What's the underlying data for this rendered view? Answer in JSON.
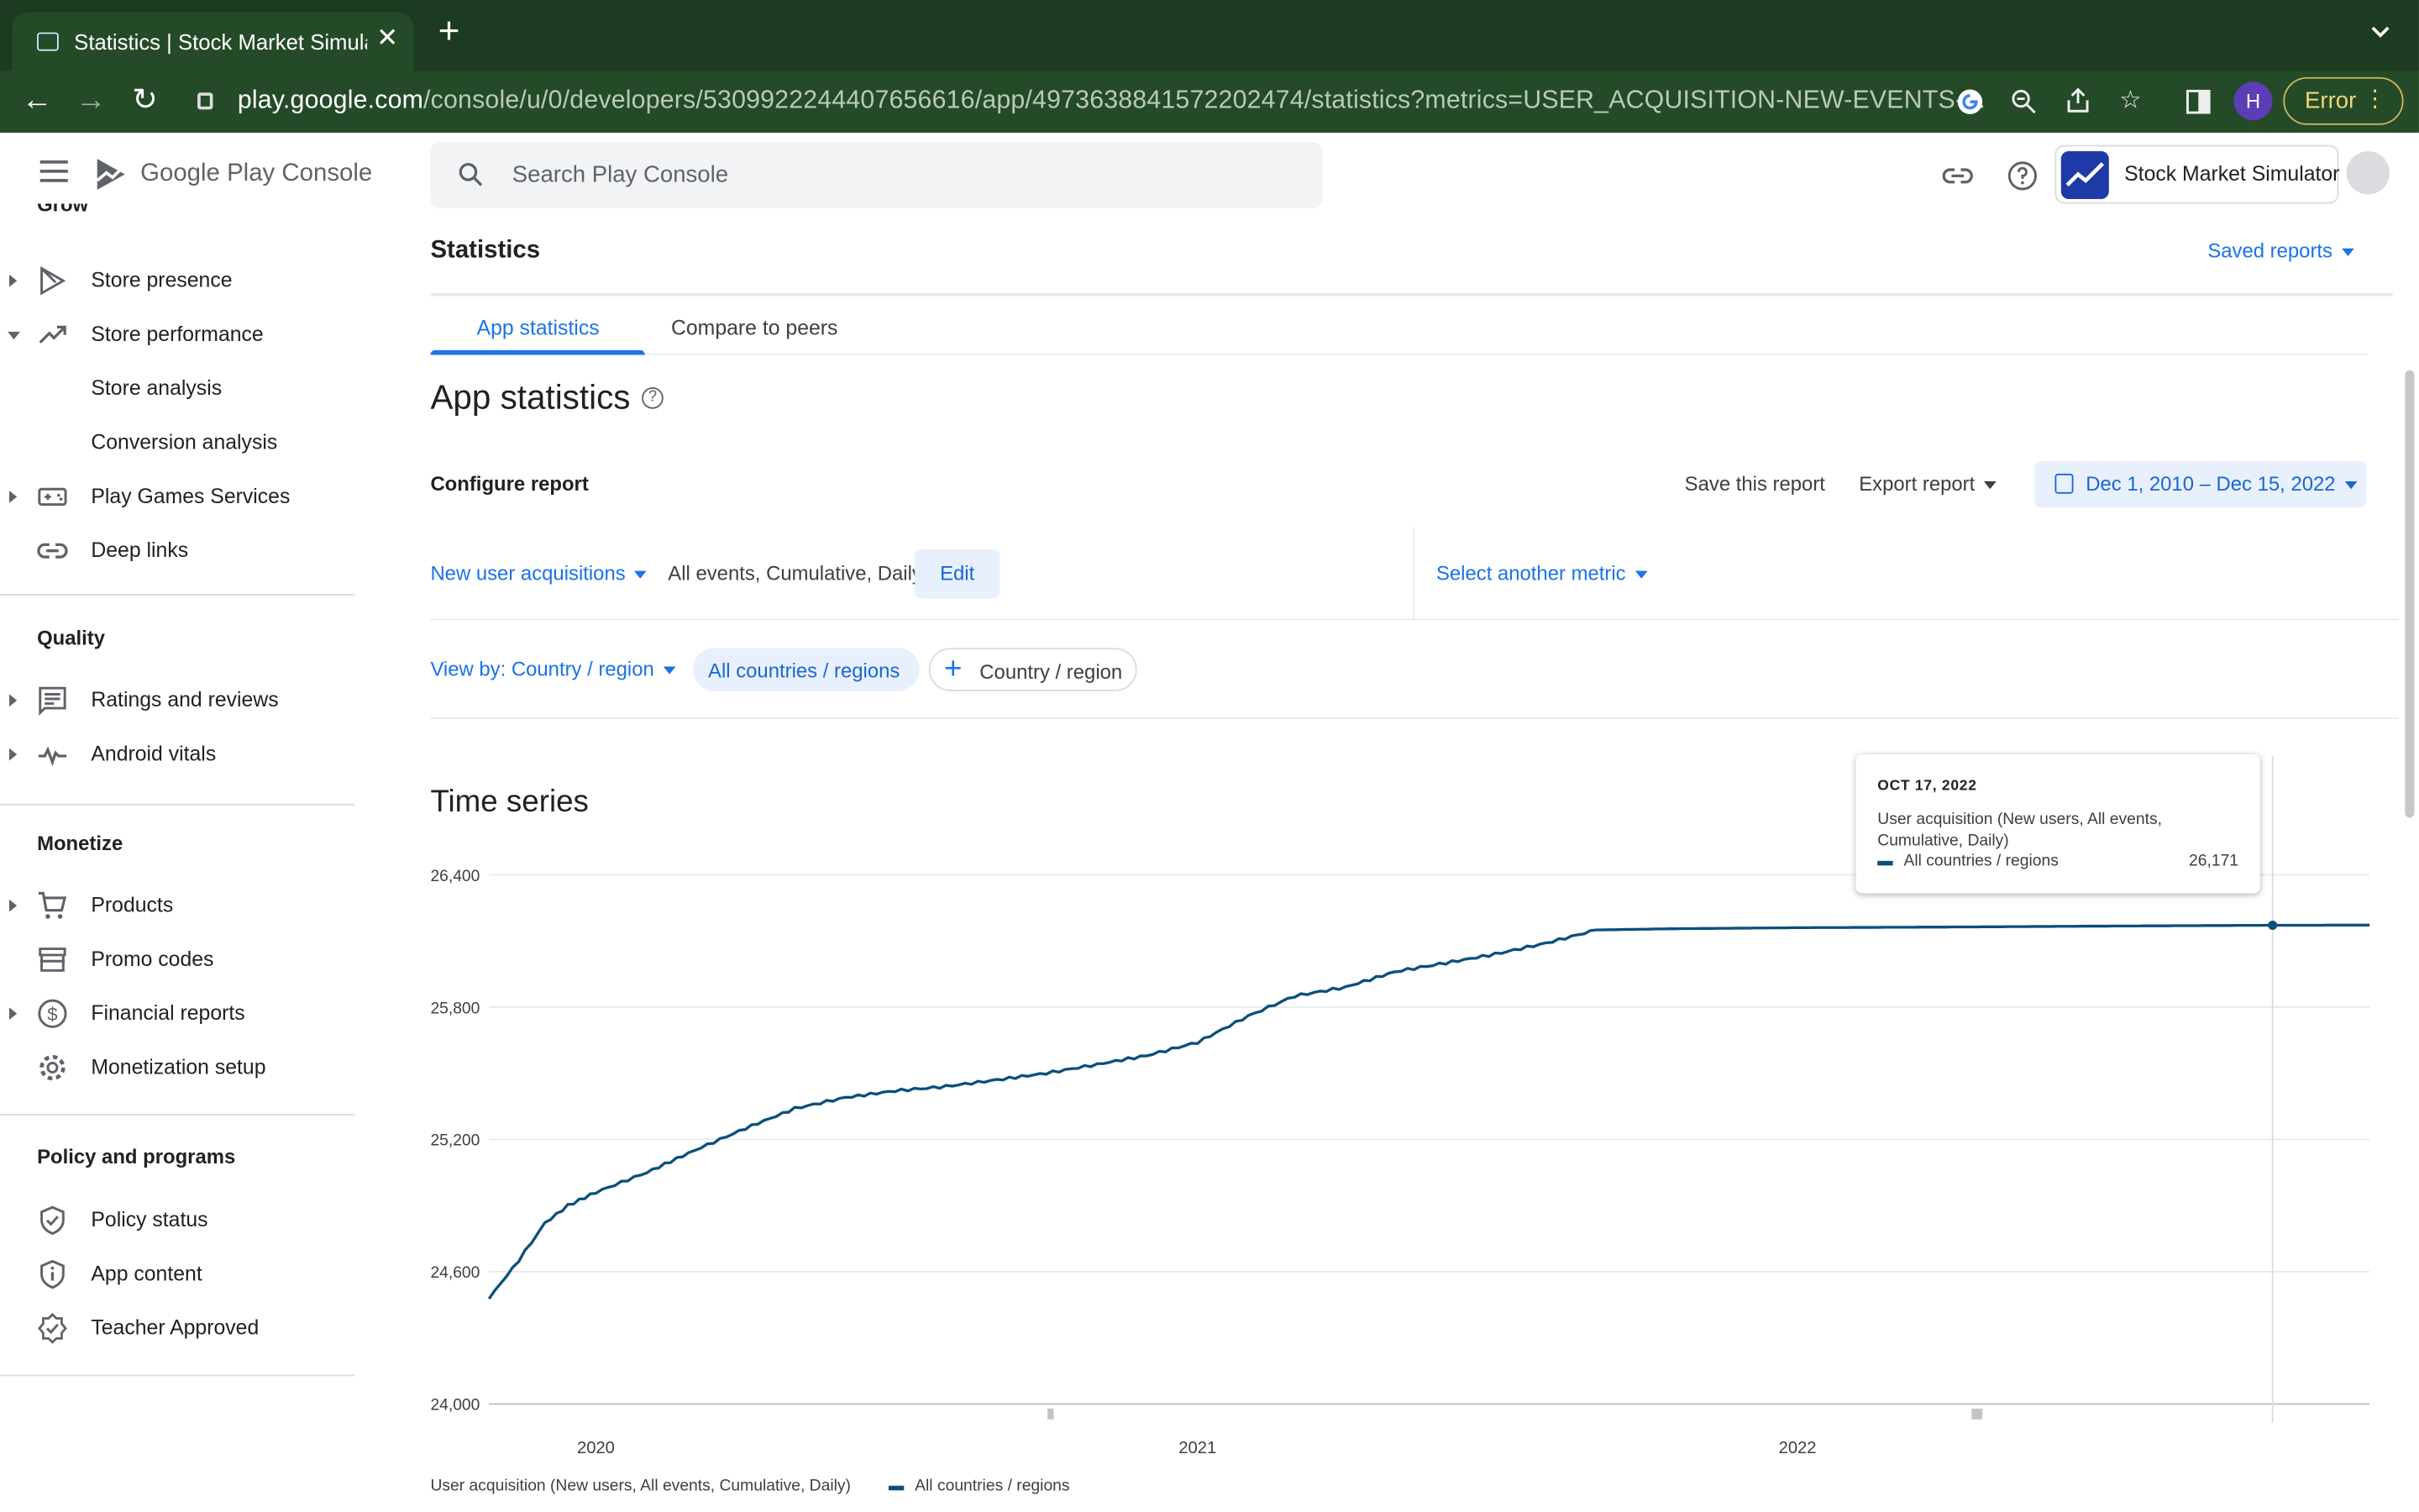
{
  "browser": {
    "tab_title": "Statistics | Stock Market Simula",
    "url_host": "play.google.com",
    "url_path": "/console/u/0/developers/5309922244407656616/app/4973638841572202474/statistics?metrics=USER_ACQUISITION-NEW-EVENTS-...",
    "profile_initial": "H",
    "error_label": "Error"
  },
  "console": {
    "brand_google": "Google Play",
    "brand_console": "Console",
    "search_placeholder": "Search Play Console",
    "app_name": "Stock Market Simulator"
  },
  "sidebar": {
    "cut_header": "Grow",
    "grow_items": [
      {
        "label": "Store presence",
        "icon": "play-store-icon"
      },
      {
        "label": "Store performance",
        "icon": "trending-up-icon"
      },
      {
        "label": "Store analysis"
      },
      {
        "label": "Conversion analysis"
      },
      {
        "label": "Play Games Services",
        "icon": "gamepad-icon"
      },
      {
        "label": "Deep links",
        "icon": "link-icon"
      }
    ],
    "quality_header": "Quality",
    "quality_items": [
      {
        "label": "Ratings and reviews",
        "icon": "reviews-icon"
      },
      {
        "label": "Android vitals",
        "icon": "vitals-icon"
      }
    ],
    "monetize_header": "Monetize",
    "monetize_items": [
      {
        "label": "Products",
        "icon": "cart-icon"
      },
      {
        "label": "Promo codes",
        "icon": "store-icon"
      },
      {
        "label": "Financial reports",
        "icon": "dollar-icon"
      },
      {
        "label": "Monetization setup",
        "icon": "gear-icon"
      }
    ],
    "policy_header": "Policy and programs",
    "policy_items": [
      {
        "label": "Policy status",
        "icon": "shield-check-icon"
      },
      {
        "label": "App content",
        "icon": "shield-info-icon"
      },
      {
        "label": "Teacher Approved",
        "icon": "badge-icon"
      }
    ]
  },
  "main": {
    "page_title": "Statistics",
    "saved_reports": "Saved reports",
    "tabs": [
      "App statistics",
      "Compare to peers"
    ],
    "heading": "App statistics",
    "configure_report": "Configure report",
    "save_report": "Save this report",
    "export_report": "Export report",
    "date_range": "Dec 1, 2010 – Dec 15, 2022",
    "metric": "New user acquisitions",
    "metric_desc": "All events, Cumulative, Daily",
    "edit": "Edit",
    "another_metric": "Select another metric",
    "view_by": "View by: Country / region",
    "all_countries": "All countries / regions",
    "add_dimension": "Country / region",
    "time_series": "Time series"
  },
  "tooltip": {
    "date": "OCT 17, 2022",
    "metric": "User acquisition (New users, All events, Cumulative, Daily)",
    "series": "All countries / regions",
    "value": "26,171"
  },
  "legend": {
    "metric": "User acquisition (New users, All events, Cumulative, Daily)",
    "series": "All countries / regions"
  },
  "colors": {
    "accent": "#1a73e8",
    "series": "#0b4f7c",
    "chrome": "#254a28"
  },
  "chart_data": {
    "type": "line",
    "x_ticks": [
      "2020",
      "2021",
      "2022"
    ],
    "y_ticks": [
      "26,400",
      "25,800",
      "25,200",
      "24,600",
      "24,000"
    ],
    "ylim": [
      24000,
      26400
    ],
    "xlim": [
      "2019-10-28",
      "2022-12-15"
    ],
    "grid": true,
    "legend_position": "bottom",
    "series": [
      {
        "name": "All countries / regions",
        "x": [
          "2019-10-28",
          "2019-11-15",
          "2019-12-01",
          "2019-12-15",
          "2020-01-01",
          "2020-02-01",
          "2020-03-01",
          "2020-04-01",
          "2020-05-01",
          "2020-06-01",
          "2020-07-01",
          "2020-08-01",
          "2020-09-01",
          "2020-10-01",
          "2020-11-01",
          "2020-12-01",
          "2021-01-01",
          "2021-02-01",
          "2021-03-01",
          "2021-04-01",
          "2021-05-01",
          "2021-06-01",
          "2021-07-01",
          "2021-08-01",
          "2021-09-01",
          "2021-10-15",
          "2022-01-01",
          "2022-04-01",
          "2022-07-01",
          "2022-10-17",
          "2022-12-15"
        ],
        "values": [
          24480,
          24650,
          24820,
          24900,
          24960,
          25050,
          25150,
          25250,
          25340,
          25390,
          25420,
          25440,
          25470,
          25500,
          25540,
          25580,
          25640,
          25760,
          25850,
          25890,
          25960,
          26000,
          26040,
          26090,
          26150,
          26155,
          26160,
          26163,
          26167,
          26171,
          26172
        ]
      }
    ]
  }
}
